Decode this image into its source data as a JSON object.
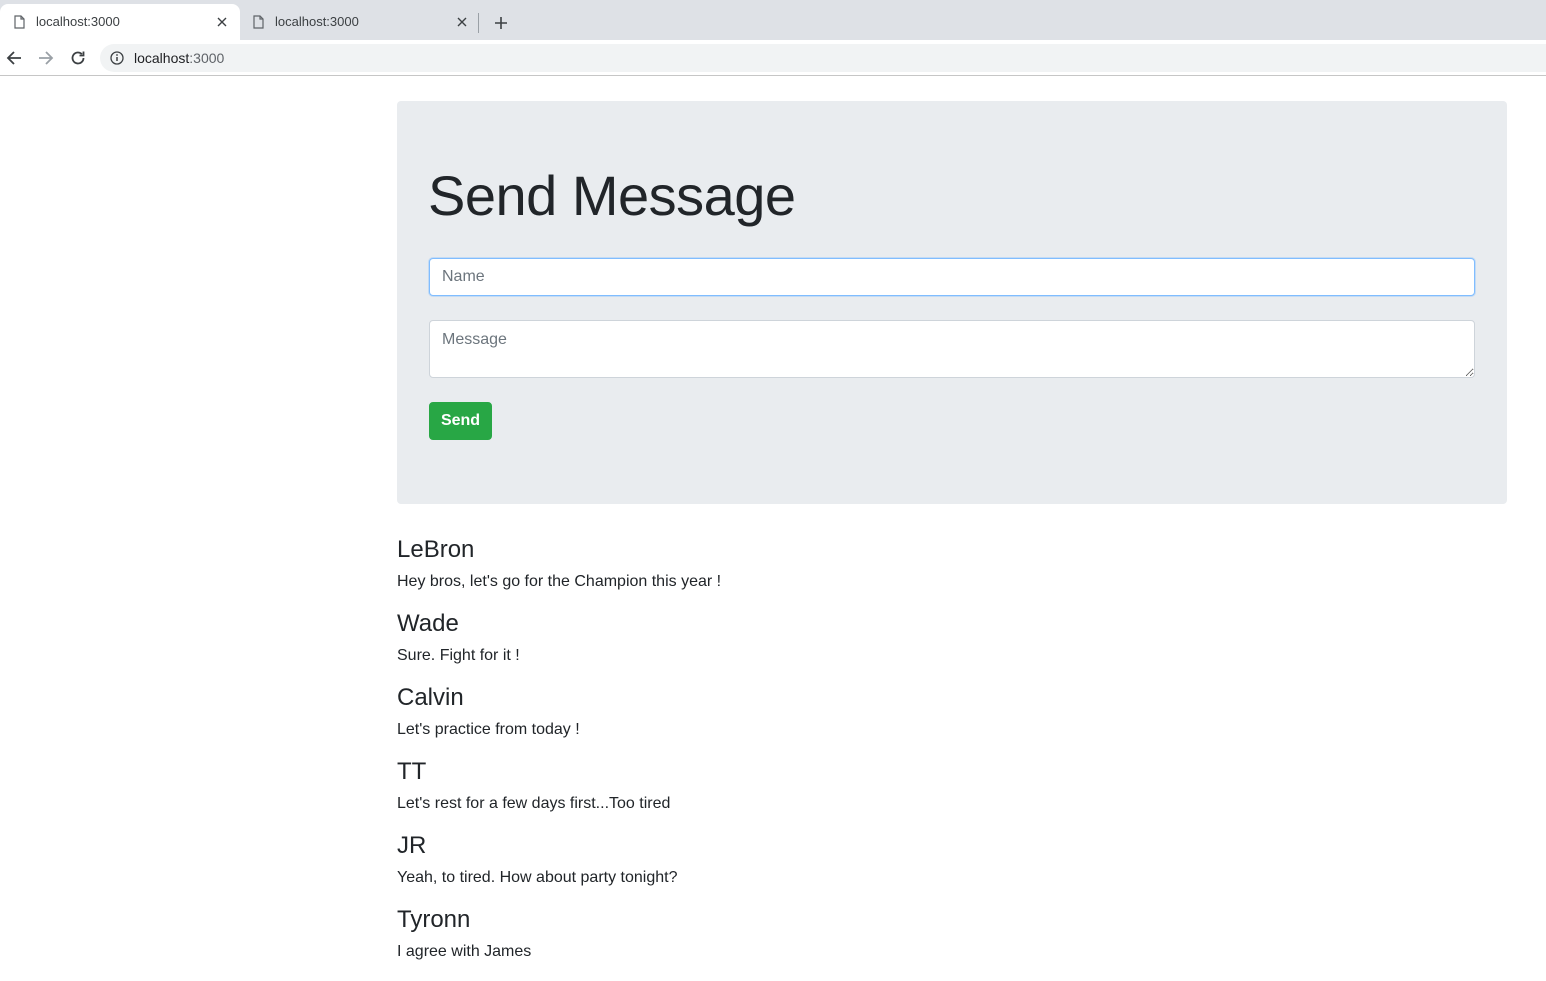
{
  "browser": {
    "tabs": [
      {
        "title": "localhost:3000",
        "active": true
      },
      {
        "title": "localhost:3000",
        "active": false
      }
    ],
    "address": {
      "host": "localhost",
      "port": ":3000"
    }
  },
  "form": {
    "title": "Send Message",
    "name_placeholder": "Name",
    "name_value": "",
    "message_placeholder": "Message",
    "message_value": "",
    "send_label": "Send"
  },
  "messages": [
    {
      "name": "LeBron",
      "text": "Hey bros, let's go for the Champion this year !"
    },
    {
      "name": "Wade",
      "text": "Sure. Fight for it !"
    },
    {
      "name": "Calvin",
      "text": "Let's practice from today !"
    },
    {
      "name": "TT",
      "text": "Let's rest for a few days first...Too tired"
    },
    {
      "name": "JR",
      "text": "Yeah, to tired. How about party tonight?"
    },
    {
      "name": "Tyronn",
      "text": "I agree with James"
    }
  ],
  "colors": {
    "jumbotron": "#e9ecef",
    "send_button": "#28a745",
    "focus_border": "#80bdff"
  },
  "icons": [
    "page-icon",
    "close-icon",
    "new-tab-icon",
    "back-icon",
    "forward-icon",
    "reload-icon",
    "info-icon"
  ]
}
